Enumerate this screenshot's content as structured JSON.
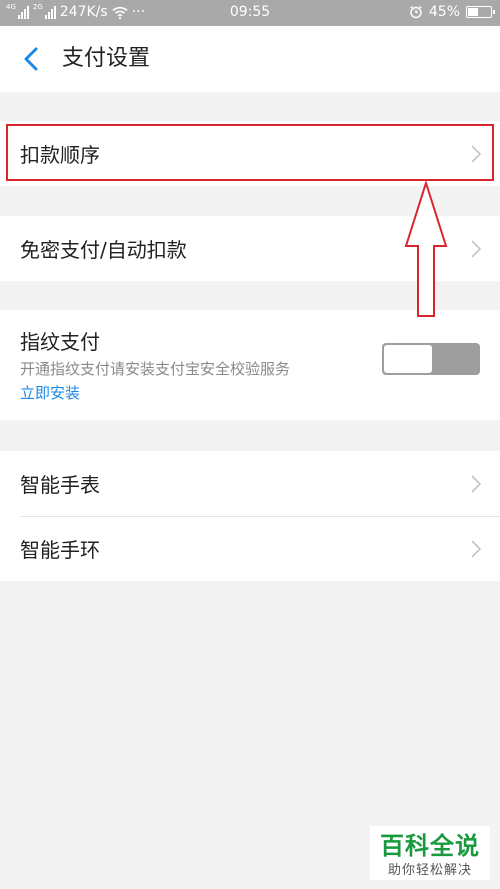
{
  "status_bar": {
    "net1": "4G",
    "net2": "2G",
    "speed": "247K/s",
    "dots": "···",
    "time": "09:55",
    "battery": "45%",
    "battery_level": 0.45
  },
  "header": {
    "title": "支付设置"
  },
  "groups": {
    "deduct_order": "扣款顺序",
    "no_password": "免密支付/自动扣款",
    "fingerprint": {
      "title": "指纹支付",
      "description": "开通指纹支付请安装支付宝安全校验服务",
      "link": "立即安装",
      "enabled": false
    },
    "smart_watch": "智能手表",
    "smart_band": "智能手环"
  },
  "watermark": {
    "title": "百科全说",
    "subtitle": "助你轻松解决"
  },
  "colors": {
    "accent": "#1e88e5",
    "highlight": "#d9262c",
    "watermark": "#1a9a3f"
  }
}
